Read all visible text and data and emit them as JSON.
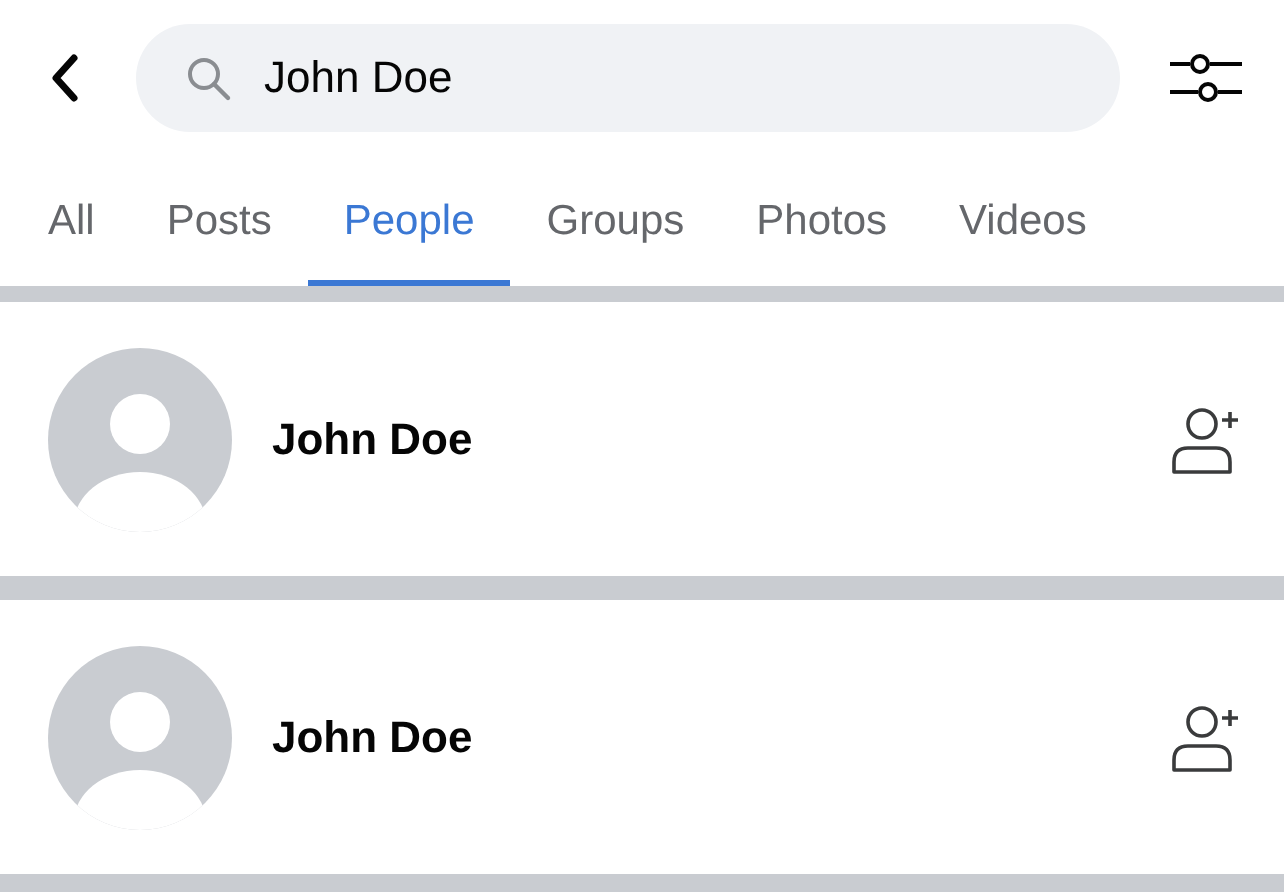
{
  "search": {
    "value": "John Doe"
  },
  "tabs": [
    {
      "label": "All",
      "selected": false
    },
    {
      "label": "Posts",
      "selected": false
    },
    {
      "label": "People",
      "selected": true
    },
    {
      "label": "Groups",
      "selected": false
    },
    {
      "label": "Photos",
      "selected": false
    },
    {
      "label": "Videos",
      "selected": false
    }
  ],
  "results": [
    {
      "name": "John Doe"
    },
    {
      "name": "John Doe"
    }
  ]
}
